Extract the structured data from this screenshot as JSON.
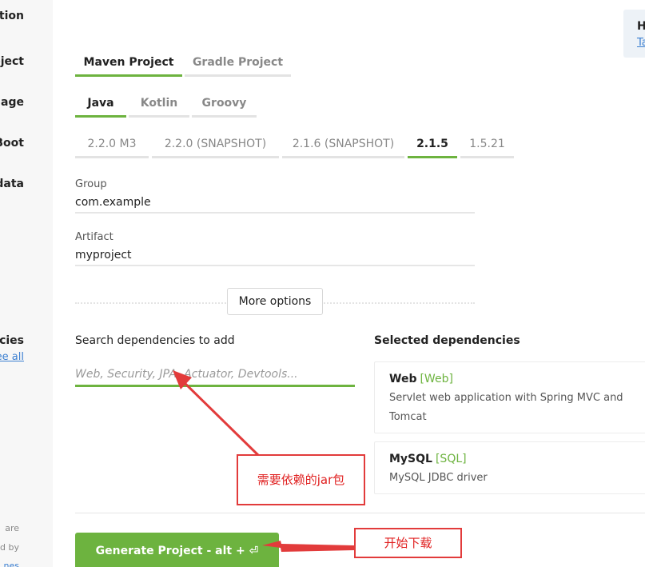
{
  "sidebar": {
    "labels": [
      "ation",
      "oject",
      "uage",
      "Boot",
      "data",
      "encies"
    ],
    "see_all": "ee all",
    "footer": [
      "are",
      "d by",
      "nes"
    ]
  },
  "help_card": {
    "heading": "H",
    "link": "Ta"
  },
  "project_tabs": [
    "Maven Project",
    "Gradle Project"
  ],
  "language_tabs": [
    "Java",
    "Kotlin",
    "Groovy"
  ],
  "boot_versions": [
    "2.2.0 M3",
    "2.2.0 (SNAPSHOT)",
    "2.1.6 (SNAPSHOT)",
    "2.1.5",
    "1.5.21"
  ],
  "selected": {
    "project": "Maven Project",
    "language": "Java",
    "boot": "2.1.5"
  },
  "group": {
    "label": "Group",
    "value": "com.example"
  },
  "artifact": {
    "label": "Artifact",
    "value": "myproject"
  },
  "more_options": "More options",
  "dependencies": {
    "search_label": "Search dependencies to add",
    "search_placeholder": "Web, Security, JPA, Actuator, Devtools...",
    "selected_title": "Selected dependencies",
    "items": [
      {
        "name": "Web",
        "tag": "[Web]",
        "desc": "Servlet web application with Spring MVC and Tomcat"
      },
      {
        "name": "MySQL",
        "tag": "[SQL]",
        "desc": "MySQL JDBC driver"
      }
    ]
  },
  "generate_button": "Generate Project - alt + ⏎",
  "annotations": {
    "jar_note": "需要依赖的jar包",
    "download_note": "开始下载"
  },
  "colors": {
    "accent": "#6db33f",
    "annotation": "#e23b3b",
    "link": "#3b7fd1"
  }
}
